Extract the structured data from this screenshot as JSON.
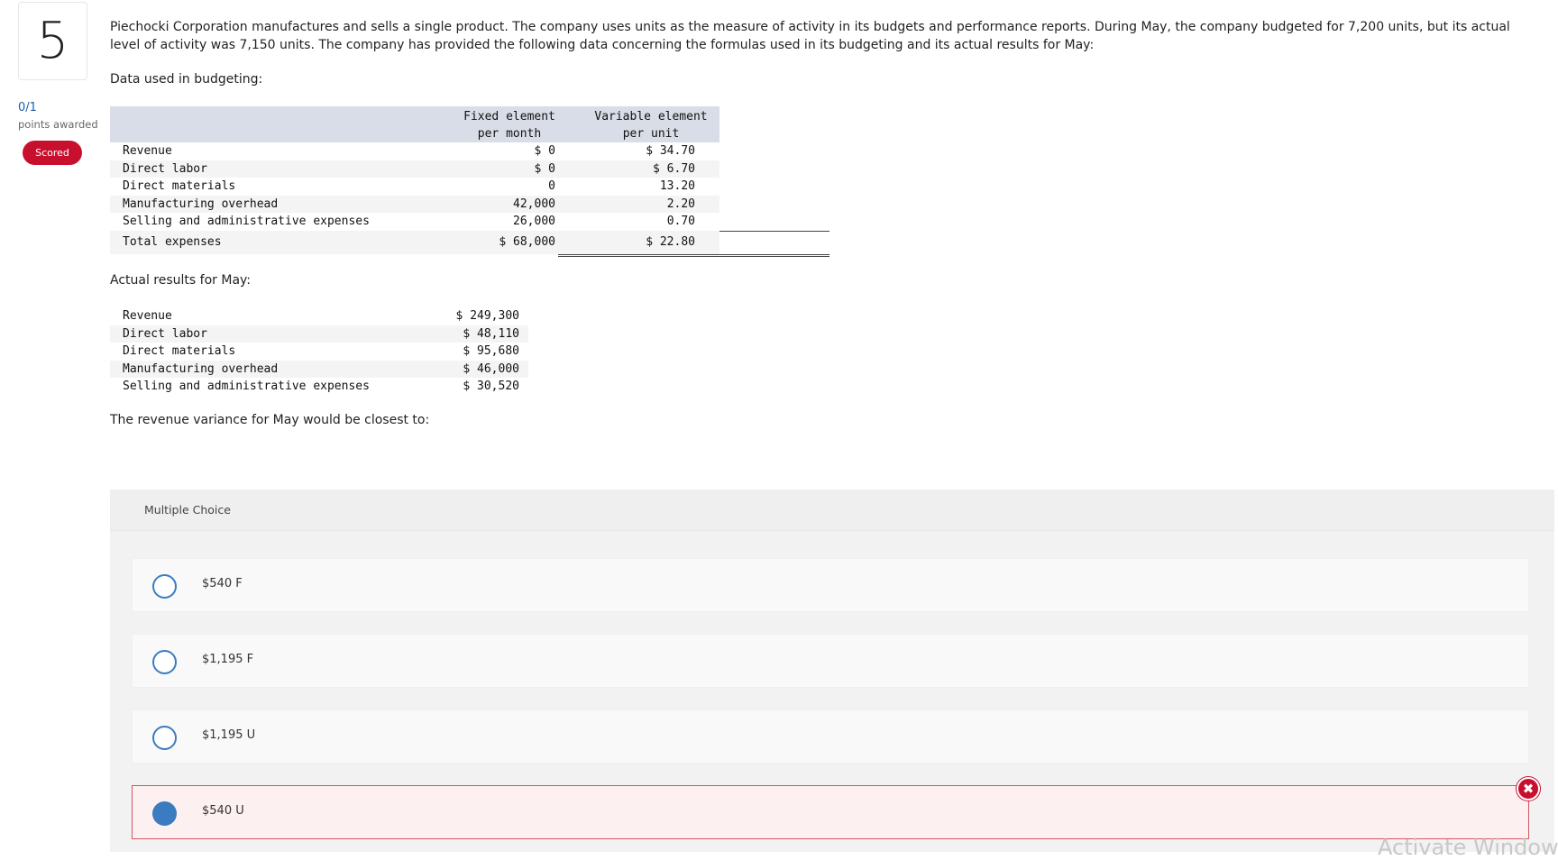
{
  "question": {
    "number": "5",
    "points": "0/1",
    "points_label": "points awarded",
    "status_badge": "Scored",
    "stem": "Piechocki Corporation manufactures and sells a single product. The company uses units as the measure of activity in its budgets and performance reports. During May, the company budgeted for 7,200 units, but its actual level of activity was 7,150 units. The company has provided the following data concerning the formulas used in its budgeting and its actual results for May:",
    "budget_label": "Data used in budgeting:",
    "actual_label": "Actual results for May:",
    "prompt": "The revenue variance for May would be closest to:"
  },
  "budget_table": {
    "col1_header_line1": "Fixed element",
    "col1_header_line2": "per month",
    "col2_header_line1": "Variable element",
    "col2_header_line2": "per unit",
    "rows": [
      {
        "label": "Revenue",
        "fixed": "$ 0",
        "variable": "$ 34.70"
      },
      {
        "label": "Direct labor",
        "fixed": "$ 0",
        "variable": "$ 6.70"
      },
      {
        "label": "Direct materials",
        "fixed": "0",
        "variable": "13.20"
      },
      {
        "label": "Manufacturing overhead",
        "fixed": "42,000",
        "variable": "2.20"
      },
      {
        "label": "Selling and administrative expenses",
        "fixed": "26,000",
        "variable": "0.70"
      }
    ],
    "total": {
      "label": "Total expenses",
      "fixed": "$ 68,000",
      "variable": "$ 22.80"
    }
  },
  "actual_table": {
    "rows": [
      {
        "label": "Revenue",
        "value": "$ 249,300"
      },
      {
        "label": "Direct labor",
        "value": "$ 48,110"
      },
      {
        "label": "Direct materials",
        "value": "$ 95,680"
      },
      {
        "label": "Manufacturing overhead",
        "value": "$ 46,000"
      },
      {
        "label": "Selling and administrative expenses",
        "value": "$ 30,520"
      }
    ]
  },
  "multiple_choice": {
    "title": "Multiple Choice",
    "options": [
      {
        "label": "$540 F",
        "selected": false
      },
      {
        "label": "$1,195 F",
        "selected": false
      },
      {
        "label": "$1,195 U",
        "selected": false
      },
      {
        "label": "$540 U",
        "selected": true
      }
    ]
  },
  "watermark": "Activate Window",
  "colors": {
    "badge_red": "#c8102e",
    "radio_blue": "#3b7bbf",
    "table_header": "#d9dde8"
  }
}
